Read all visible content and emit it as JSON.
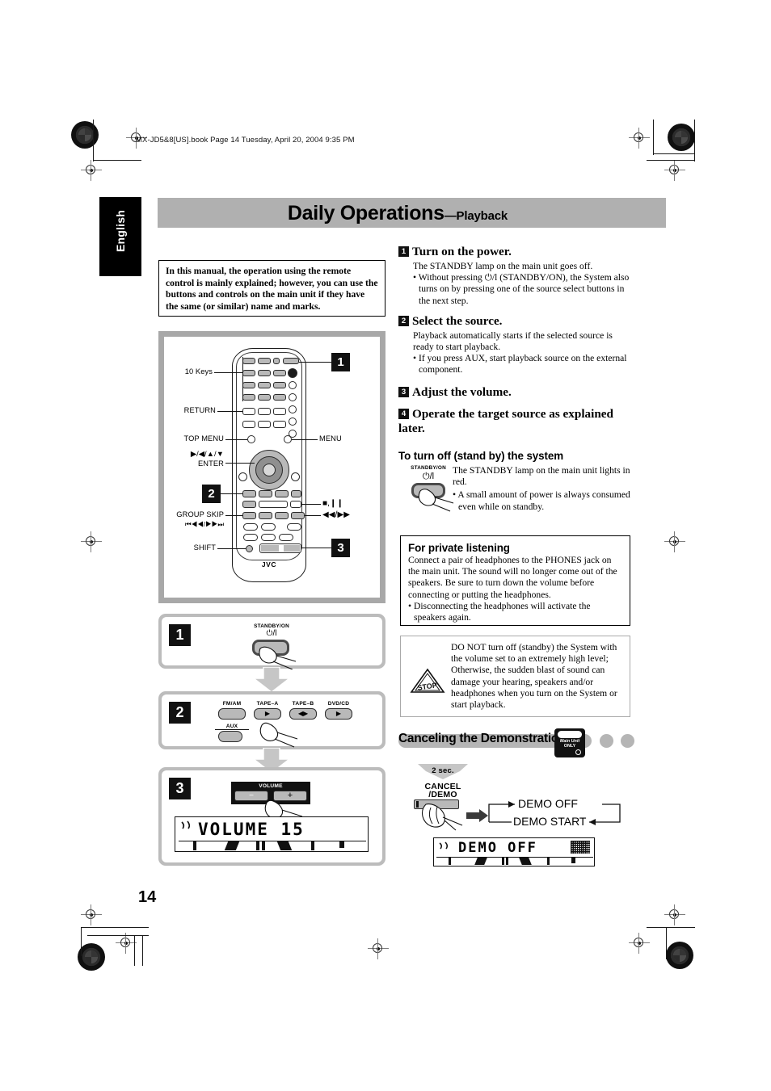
{
  "document": {
    "file_header": "MX-JD5&8[US].book  Page 14  Tuesday, April 20, 2004  9:35 PM",
    "language_tab": "English",
    "page_number": "14",
    "title_main": "Daily Operations",
    "title_sub": "—Playback"
  },
  "note_box": {
    "text": "In this manual, the operation using the remote control is mainly explained; however, you can use the buttons and controls on the main unit if they have the same (or similar) name and marks."
  },
  "remote_diagram": {
    "labels_left": [
      "10 Keys",
      "RETURN",
      "TOP MENU",
      "▶/◀/▲/▼",
      "ENTER",
      "GROUP SKIP",
      "⏮◀◀/▶▶⏭",
      "SHIFT"
    ],
    "labels_right": [
      "MENU",
      "■,❙❙",
      "◀◀/▶▶"
    ],
    "brand": "JVC",
    "step_badges": [
      "1",
      "2",
      "3"
    ]
  },
  "steps_right": [
    {
      "num": "1",
      "title": "Turn on the power.",
      "body": "The STANDBY lamp on the main unit goes off.",
      "bullets": [
        "• Without pressing ⏻/l (STANDBY/ON), the System also turns on by pressing one of the source select buttons in the next step."
      ]
    },
    {
      "num": "2",
      "title": "Select the source.",
      "body": "Playback automatically starts if the selected source is ready to start playback.",
      "bullets": [
        "• If you press AUX, start playback source on the external component."
      ]
    },
    {
      "num": "3",
      "title": "Adjust the volume.",
      "body": "",
      "bullets": []
    },
    {
      "num": "4",
      "title": "Operate the target source as explained later.",
      "body": "",
      "bullets": []
    }
  ],
  "standby_section": {
    "heading": "To turn off (stand by) the system",
    "button_caption": "STANDBY/ON",
    "button_symbol": "⏻/l",
    "body": "The STANDBY lamp on the main unit lights in red.",
    "bullets": [
      "• A small amount of power is always consumed even while on standby."
    ]
  },
  "private_listening": {
    "heading": "For private listening",
    "body": "Connect a pair of headphones to the PHONES jack on the main unit. The sound will no longer come out of the speakers. Be sure to turn down the volume before connecting or putting the headphones.",
    "bullets": [
      "• Disconnecting the headphones will activate the speakers again."
    ]
  },
  "caution_box": {
    "icon_label": "STOP",
    "body": "DO NOT turn off (standby) the System with the volume set to an extremely high level; Otherwise, the sudden blast of sound can damage your hearing, speakers and/or headphones when you turn on the System or start playback."
  },
  "demo_section": {
    "heading": "Canceling the Demonstration",
    "badge_line1": "Main Unit",
    "badge_line2": "ONLY",
    "hold_time": "2 sec.",
    "button_line1": "CANCEL",
    "button_line2": "/DEMO",
    "cycle": [
      "DEMO OFF",
      "DEMO START"
    ],
    "lcd_text": "DEMO OFF"
  },
  "panels": {
    "step1": {
      "num": "1",
      "caption": "STANDBY/ON",
      "symbol": "⏻/l"
    },
    "step2": {
      "num": "2",
      "buttons": [
        {
          "label": "FM/AM",
          "symbol": ""
        },
        {
          "label": "TAPE–A",
          "symbol": "▶"
        },
        {
          "label": "TAPE–B",
          "symbol": "◀▶"
        },
        {
          "label": "DVD/CD",
          "symbol": "▶"
        }
      ],
      "aux_label": "AUX"
    },
    "step3": {
      "num": "3",
      "caption": "VOLUME",
      "minus": "−",
      "plus": "+",
      "lcd_text": "VOLUME  15"
    }
  },
  "colors": {
    "title_bar": "#b0b0b0",
    "panel_frame": "#bcbcbc",
    "button_face": "#b9b9b9",
    "dot": "#b5b5b5"
  }
}
